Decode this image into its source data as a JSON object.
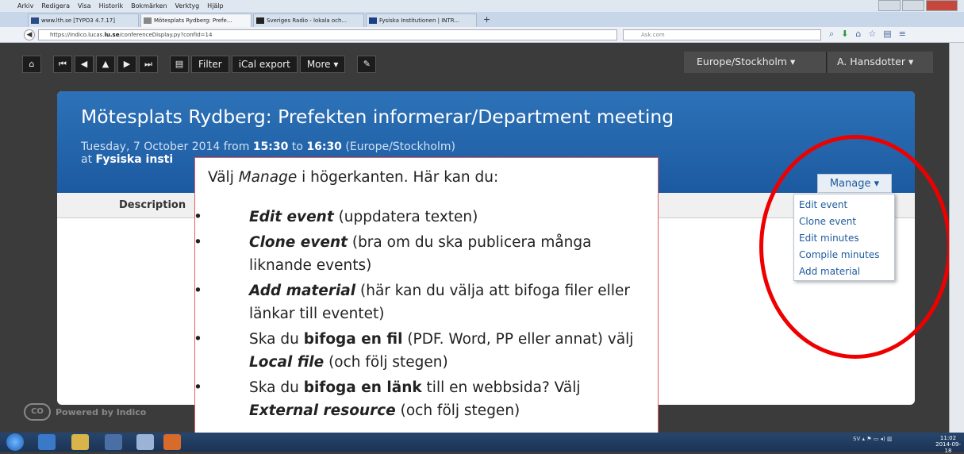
{
  "browser": {
    "menubar": [
      "Arkiv",
      "Redigera",
      "Visa",
      "Historik",
      "Bokmärken",
      "Verktyg",
      "Hjälp"
    ],
    "tabs": [
      {
        "label": "www.lth.se [TYPO3 4.7.17]"
      },
      {
        "label": "Mötesplats Rydberg: Prefe..."
      },
      {
        "label": "Sveriges Radio - lokala och..."
      },
      {
        "label": "Fysiska Institutionen | INTR..."
      }
    ],
    "url_prefix": "https://indico.lucas.",
    "url_host": "lu.se",
    "url_path": "/conferenceDisplay.py?confId=14",
    "search_placeholder": "Ask.com"
  },
  "toolbar": {
    "filter": "Filter",
    "ical": "iCal export",
    "more": "More ▾",
    "timezone": "Europe/Stockholm ▾",
    "user": "A. Hansdotter ▾"
  },
  "event": {
    "title": "Mötesplats Rydberg: Prefekten informerar/Department meeting",
    "date_prefix": "Tuesday, 7 October 2014 from ",
    "start": "15:30",
    "to": " to ",
    "end": "16:30",
    "tz": " (Europe/Stockholm)",
    "at": "at ",
    "location": "Fysiska insti"
  },
  "nav": {
    "description": "Description"
  },
  "manage": {
    "button": "Manage ▾",
    "items": [
      "Edit event",
      "Clone event",
      "Edit minutes",
      "Compile minutes",
      "Add material"
    ]
  },
  "callout": {
    "intro_a": "Välj ",
    "intro_em": "Manage",
    "intro_b": " i högerkanten. Här kan du:",
    "b1_em": "Edit event",
    "b1": " (uppdatera texten)",
    "b2_em": "Clone event",
    "b2": " (bra om du ska publicera många liknande events)",
    "b3_em": "Add material",
    "b3": " (här kan du välja att bifoga filer eller länkar till eventet)",
    "b4_a": "Ska du ",
    "b4_b": "bifoga en fil",
    "b4_c": " (PDF. Word, PP eller annat) välj ",
    "b4_d": "Local file",
    "b4_e": " (och följ stegen)",
    "b5_a": "Ska du ",
    "b5_b": "bifoga en länk",
    "b5_c": " till en webbsida? Välj ",
    "b5_d": "External resource",
    "b5_e": " (och följ stegen)"
  },
  "footer": {
    "powered": "Powered by Indico"
  },
  "taskbar": {
    "lang": "SV",
    "time": "11:02",
    "date": "2014-09-18"
  },
  "colors": {
    "header_blue": "#2266ad",
    "ring_red": "#e00000",
    "link_blue": "#1d5a9e"
  }
}
